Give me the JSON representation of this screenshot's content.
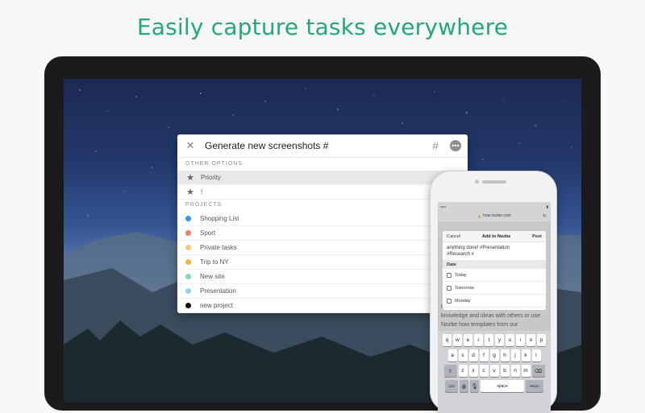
{
  "headline": "Easily capture tasks everywhere",
  "colors": {
    "accent": "#24a87a"
  },
  "popup": {
    "input_value": "Generate new screenshots #",
    "close_icon": "close-icon",
    "hash_icon": "#",
    "more_icon": "more-icon",
    "other_options_label": "OTHER OPTIONS",
    "options": [
      {
        "label": "Priority",
        "icon": "star-icon"
      },
      {
        "label": "!",
        "icon": "star-icon"
      }
    ],
    "projects_label": "PROJECTS",
    "projects": [
      {
        "label": "Shopping List",
        "color": "#2d9be6"
      },
      {
        "label": "Sport",
        "color": "#f07b72"
      },
      {
        "label": "Private tasks",
        "color": "#f2c879"
      },
      {
        "label": "Trip to NY",
        "color": "#f3b23a"
      },
      {
        "label": "New site",
        "color": "#7fdcae"
      },
      {
        "label": "Presentation",
        "color": "#8fd3f0"
      },
      {
        "label": "new project",
        "color": "#111111"
      }
    ]
  },
  "phone": {
    "url": "how.nozbe.com",
    "sheet": {
      "cancel": "Cancel",
      "title": "Add to Nozbe",
      "post": "Post",
      "text_line1": "anything done! #Presentation",
      "text_line2": "#Research #",
      "date_label": "Date",
      "dates": [
        "Today",
        "Tomorrow",
        "Monday"
      ]
    },
    "page_text": "Create your own templates to share knowledge and ideas with others or use Nozbe how templates from our",
    "keyboard": {
      "row1": [
        "q",
        "w",
        "e",
        "r",
        "t",
        "y",
        "u",
        "i",
        "o",
        "p"
      ],
      "row2": [
        "a",
        "s",
        "d",
        "f",
        "g",
        "h",
        "j",
        "k",
        "l"
      ],
      "row3": [
        "z",
        "x",
        "c",
        "v",
        "b",
        "n",
        "m"
      ],
      "numbers_key": "123",
      "space_key": "space",
      "return_key": "return"
    }
  }
}
